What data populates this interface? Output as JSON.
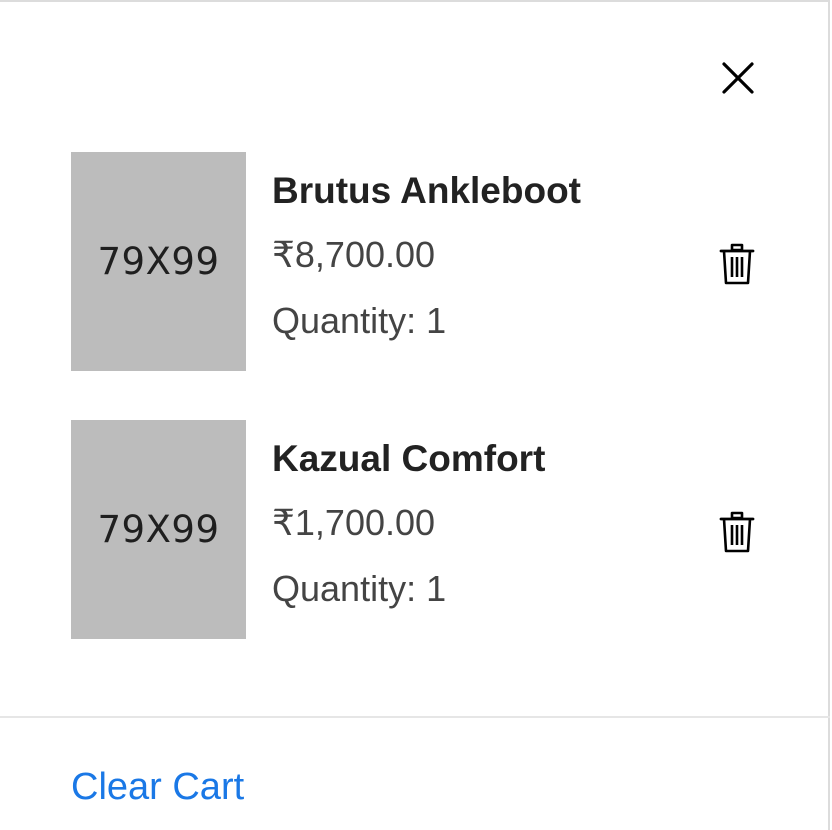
{
  "header": {
    "close_icon": "close-icon"
  },
  "cart": {
    "items": [
      {
        "image_placeholder": "79X99",
        "name": "Brutus Ankleboot",
        "price": "₹8,700.00",
        "quantity_label": "Quantity:",
        "quantity": "1",
        "delete_icon": "trash-icon"
      },
      {
        "image_placeholder": "79X99",
        "name": "Kazual Comfort",
        "price": "₹1,700.00",
        "quantity_label": "Quantity:",
        "quantity": "1",
        "delete_icon": "trash-icon"
      }
    ]
  },
  "footer": {
    "clear_cart_label": "Clear Cart"
  },
  "colors": {
    "accent": "#1a78e6",
    "placeholder_bg": "#bcbcbc",
    "text_dark": "#222222",
    "text_muted": "#444444"
  }
}
